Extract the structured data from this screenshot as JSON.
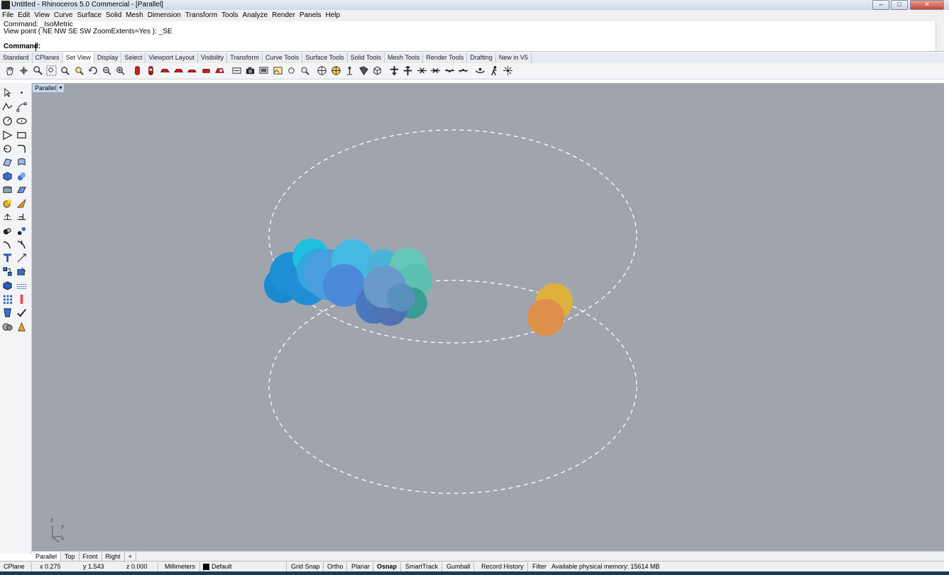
{
  "window": {
    "title": "Untitled - Rhinoceros 5.0 Commercial - [Parallel]",
    "minimize_icon": "minimize-icon",
    "maximize_icon": "maximize-icon",
    "close_icon": "close-icon",
    "min_glyph": "–",
    "max_glyph": "□",
    "close_glyph": "✕"
  },
  "menu": [
    "File",
    "Edit",
    "View",
    "Curve",
    "Surface",
    "Solid",
    "Mesh",
    "Dimension",
    "Transform",
    "Tools",
    "Analyze",
    "Render",
    "Panels",
    "Help"
  ],
  "command_history": [
    "Command: _IsoMetric",
    "View point ( NE  NW  SE  SW  ZoomExtents=Yes ): _SE"
  ],
  "command_prompt": {
    "label": "Command:",
    "value": ""
  },
  "toolbar_tabs": [
    "Standard",
    "CPlanes",
    "Set View",
    "Display",
    "Select",
    "Viewport Layout",
    "Visibility",
    "Transform",
    "Curve Tools",
    "Surface Tools",
    "Solid Tools",
    "Mesh Tools",
    "Render Tools",
    "Drafting",
    "New in V5"
  ],
  "toolbar_tabs_active": "Set View",
  "viewport": {
    "title": "Parallel",
    "dropdown_glyph": "▾",
    "background": "#a0a5ad",
    "axes_labels": {
      "z": "z",
      "y": "y",
      "x": "x"
    }
  },
  "view_tabs": [
    "Parallel",
    "Top",
    "Front",
    "Right"
  ],
  "view_tabs_active": "Parallel",
  "add_view_glyph": "+",
  "status": {
    "cplane": "CPlane",
    "x": "x 0.275",
    "y": "y 1.543",
    "z": "z 0.000",
    "units": "Millimeters",
    "layer": "Default",
    "layer_color": "#000000",
    "toggles": [
      "Grid Snap",
      "Ortho",
      "Planar",
      "Osnap",
      "SmartTrack",
      "Gumball",
      "Record History",
      "Filter"
    ],
    "toggles_bold": "Osnap",
    "memory": "Available physical memory: 15614 MB"
  },
  "scene_colors": {
    "blue": "#1e8fd4",
    "cyan": "#22c4dc",
    "sky": "#4aa8e0",
    "slate": "#4f7ec0",
    "teal": "#3a9a96",
    "mint": "#68c8b0",
    "gold": "#e0b43a",
    "orange": "#e0904a"
  }
}
